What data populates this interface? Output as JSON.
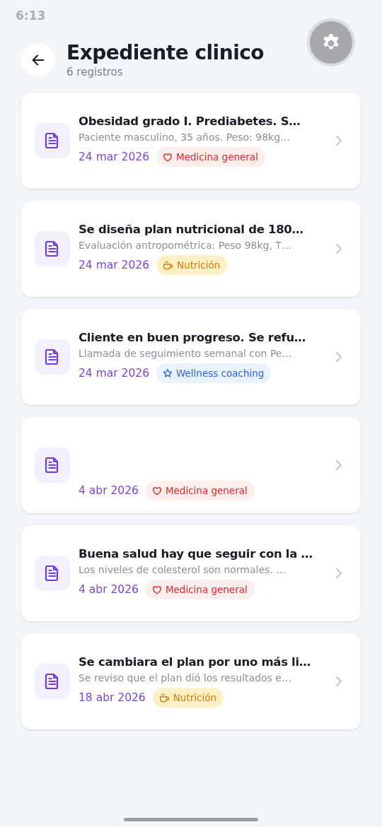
{
  "status_bar": {
    "time": "6:13"
  },
  "header": {
    "title": "Expediente clinico",
    "subtitle": "6 registros"
  },
  "records": [
    {
      "title": "Obesidad grado I. Prediabetes. S…",
      "summary": "Paciente masculino, 35 años. Peso: 98kg…",
      "date": "24 mar 2026",
      "tag": {
        "kind": "medicine",
        "label": "Medicina general"
      }
    },
    {
      "title": "Se diseña plan nutricional de 180…",
      "summary": "Evaluación antropométrica: Peso 98kg, T…",
      "date": "24 mar 2026",
      "tag": {
        "kind": "nutrition",
        "label": "Nutrición"
      }
    },
    {
      "title": "Cliente en buen progreso. Se refu…",
      "summary": "Llamada de seguimiento semanal con Pe…",
      "date": "24 mar 2026",
      "tag": {
        "kind": "wellness",
        "label": "Wellness coaching"
      }
    },
    {
      "date": "4 abr 2026",
      "tag": {
        "kind": "medicine",
        "label": "Medicina general"
      }
    },
    {
      "title": "Buena salud hay que seguir con la …",
      "summary": "Los niveles de colesterol son normales. …",
      "date": "4 abr 2026",
      "tag": {
        "kind": "medicine",
        "label": "Medicina general"
      }
    },
    {
      "title": "Se cambiara el plan por uno más li…",
      "summary": "Se reviso que el plan dió los resultados e…",
      "date": "18 abr 2026",
      "tag": {
        "kind": "nutrition",
        "label": "Nutrición"
      }
    }
  ]
}
